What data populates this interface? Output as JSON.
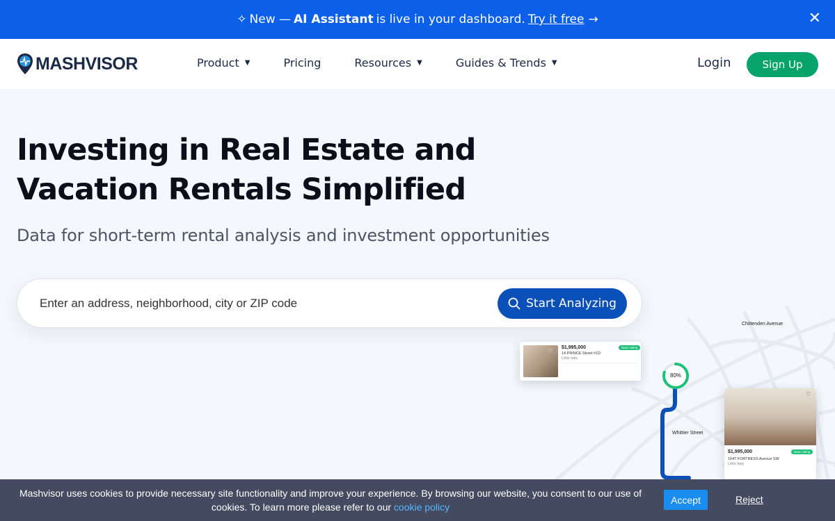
{
  "announcement": {
    "prefix": "New —",
    "highlight": "AI Assistant",
    "text": "is live in your dashboard.",
    "cta": "Try it free",
    "arrow_icon": "arrow-right-icon",
    "close_icon": "close-icon"
  },
  "header": {
    "logo_text": "MASHVISOR",
    "nav": [
      {
        "label": "Product",
        "has_dropdown": true
      },
      {
        "label": "Pricing",
        "has_dropdown": false
      },
      {
        "label": "Resources",
        "has_dropdown": true
      },
      {
        "label": "Guides & Trends",
        "has_dropdown": true
      }
    ],
    "login_label": "Login",
    "signup_label": "Sign Up"
  },
  "hero": {
    "title": "Investing in Real Estate and Vacation Rentals Simplified",
    "subtitle": "Data for short-term rental analysis and investment opportunities",
    "search_placeholder": "Enter an address, neighborhood, city or ZIP code",
    "search_button": "Start Analyzing"
  },
  "map": {
    "streets": [
      "Chittenden Avenue",
      "Whittier Street"
    ],
    "progress_label": "80%",
    "progress_value": 0.8,
    "card1": {
      "price": "$1,995,000",
      "address": "14 PRINCE Street #1D",
      "area": "Little Italy",
      "tag": "New Listing"
    },
    "card2": {
      "price": "$1,995,000",
      "address": "1047 FORTRESS Avenue SW",
      "area": "Little Italy",
      "tag": "New Listing"
    }
  },
  "cookie": {
    "text": "Mashvisor uses cookies to provide necessary site functionality and improve your experience. By browsing our website, you consent to our use of cookies. To learn more please refer to our",
    "link": "cookie policy",
    "accept": "Accept",
    "reject": "Reject"
  },
  "colors": {
    "announce_bg": "#0b5fe8",
    "signup_bg": "#06a36c",
    "start_btn_bg": "#0b4fb8",
    "cookie_bg": "#444a60",
    "accept_bg": "#1a8df0"
  }
}
